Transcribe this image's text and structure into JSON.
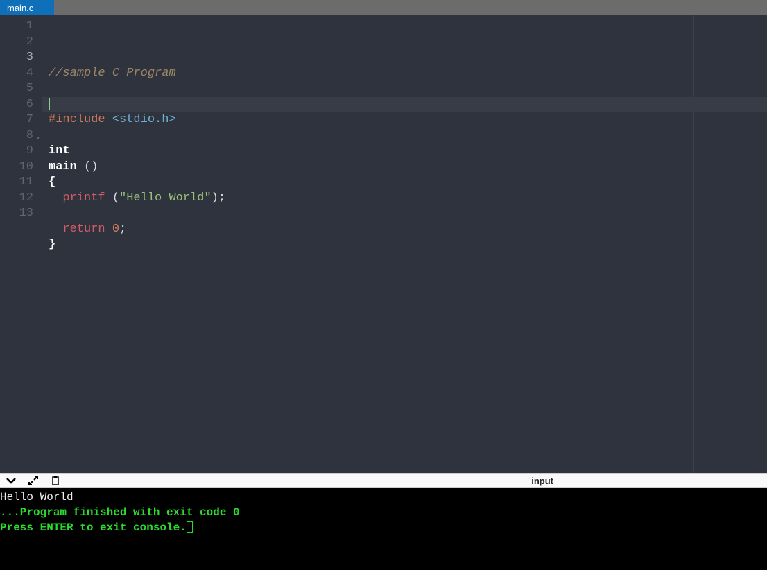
{
  "tab": {
    "filename": "main.c"
  },
  "editor": {
    "active_line": 3,
    "lines": [
      {
        "n": 1,
        "tokens": [
          {
            "t": "//sample C Program",
            "c": "c-comment"
          }
        ]
      },
      {
        "n": 2,
        "tokens": []
      },
      {
        "n": 3,
        "tokens": []
      },
      {
        "n": 4,
        "tokens": [
          {
            "t": "#include ",
            "c": "c-preproc"
          },
          {
            "t": "<stdio.h>",
            "c": "c-include"
          }
        ]
      },
      {
        "n": 5,
        "tokens": []
      },
      {
        "n": 6,
        "tokens": [
          {
            "t": "int",
            "c": "c-keyword"
          }
        ]
      },
      {
        "n": 7,
        "tokens": [
          {
            "t": "main ",
            "c": "c-keyword"
          },
          {
            "t": "()",
            "c": "c-punct"
          }
        ]
      },
      {
        "n": 8,
        "tokens": [
          {
            "t": "{",
            "c": "c-brace"
          }
        ],
        "fold": true
      },
      {
        "n": 9,
        "tokens": [
          {
            "t": "  ",
            "c": ""
          },
          {
            "t": "printf ",
            "c": "c-func"
          },
          {
            "t": "(",
            "c": "c-punct"
          },
          {
            "t": "\"Hello World\"",
            "c": "c-string"
          },
          {
            "t": ");",
            "c": "c-punct"
          }
        ]
      },
      {
        "n": 10,
        "tokens": []
      },
      {
        "n": 11,
        "tokens": [
          {
            "t": "  ",
            "c": ""
          },
          {
            "t": "return ",
            "c": "c-func"
          },
          {
            "t": "0",
            "c": "c-number"
          },
          {
            "t": ";",
            "c": "c-punct"
          }
        ]
      },
      {
        "n": 12,
        "tokens": [
          {
            "t": "}",
            "c": "c-brace"
          }
        ]
      },
      {
        "n": 13,
        "tokens": []
      }
    ]
  },
  "toolbar": {
    "input_label": "input"
  },
  "console": {
    "lines": [
      {
        "text": "Hello World",
        "cls": "out-white"
      },
      {
        "text": "",
        "cls": ""
      },
      {
        "text": "...Program finished with exit code 0",
        "cls": "out-green"
      },
      {
        "text": "Press ENTER to exit console.",
        "cls": "out-green",
        "cursor": true
      }
    ]
  }
}
